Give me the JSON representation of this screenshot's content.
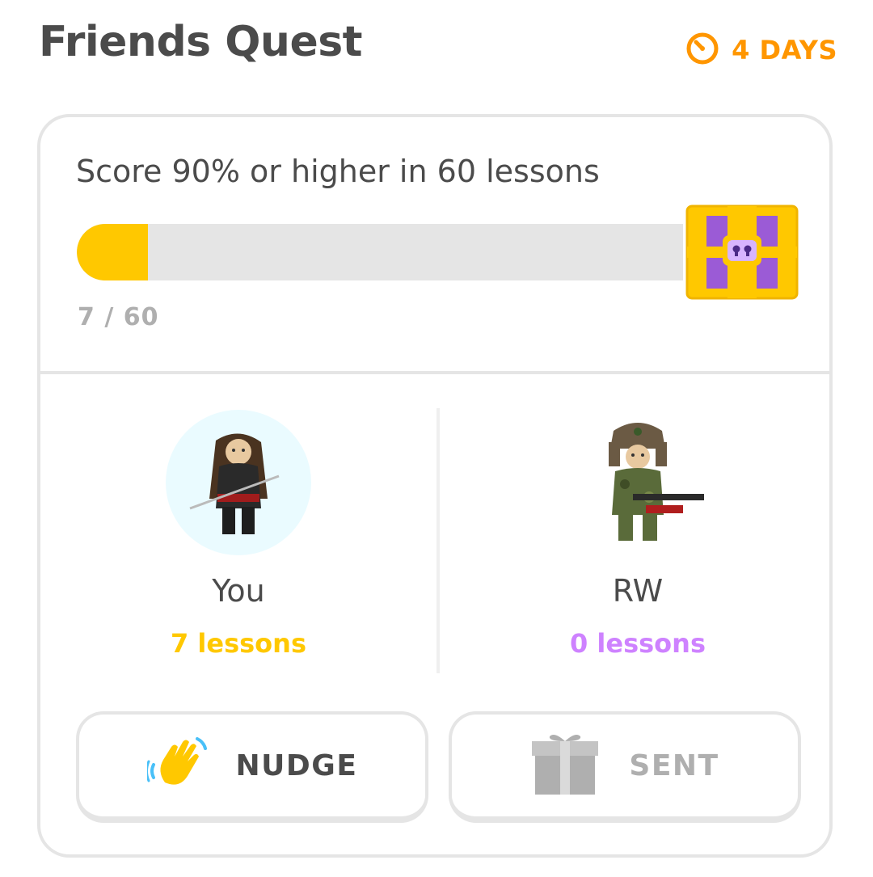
{
  "header": {
    "title": "Friends Quest",
    "timer_label": "4 DAYS"
  },
  "quest": {
    "goal": "Score 90% or higher in 60 lessons",
    "progress_text": "7 / 60",
    "progress_fraction": 0.117
  },
  "members": [
    {
      "name": "You",
      "lessons": "7 lessons",
      "color": "#ffc800"
    },
    {
      "name": "RW",
      "lessons": "0 lessons",
      "color": "#ce82ff"
    }
  ],
  "actions": {
    "nudge_label": "NUDGE",
    "sent_label": "SENT"
  },
  "colors": {
    "accent": "#ff9600",
    "progress": "#ffc800",
    "text": "#4b4b4b",
    "muted": "#afafaf"
  },
  "icons": {
    "timer": "timer-icon",
    "chest": "treasure-chest-icon",
    "nudge": "waving-hand-icon",
    "sent": "gift-icon"
  }
}
